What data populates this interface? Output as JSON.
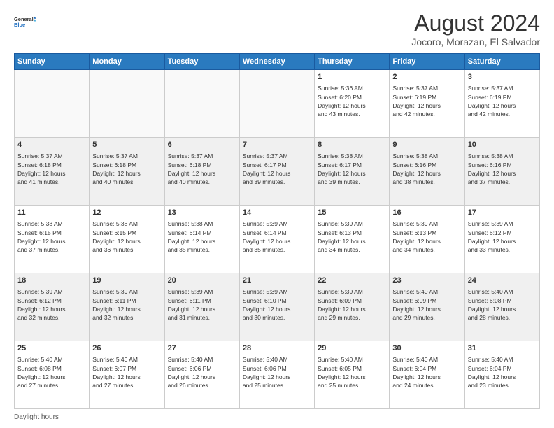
{
  "header": {
    "logo_line1": "General",
    "logo_line2": "Blue",
    "main_title": "August 2024",
    "subtitle": "Jocoro, Morazan, El Salvador"
  },
  "days_of_week": [
    "Sunday",
    "Monday",
    "Tuesday",
    "Wednesday",
    "Thursday",
    "Friday",
    "Saturday"
  ],
  "weeks": [
    [
      {
        "day": "",
        "info": "",
        "empty": true
      },
      {
        "day": "",
        "info": "",
        "empty": true
      },
      {
        "day": "",
        "info": "",
        "empty": true
      },
      {
        "day": "",
        "info": "",
        "empty": true
      },
      {
        "day": "1",
        "info": "Sunrise: 5:36 AM\nSunset: 6:20 PM\nDaylight: 12 hours\nand 43 minutes."
      },
      {
        "day": "2",
        "info": "Sunrise: 5:37 AM\nSunset: 6:19 PM\nDaylight: 12 hours\nand 42 minutes."
      },
      {
        "day": "3",
        "info": "Sunrise: 5:37 AM\nSunset: 6:19 PM\nDaylight: 12 hours\nand 42 minutes."
      }
    ],
    [
      {
        "day": "4",
        "info": "Sunrise: 5:37 AM\nSunset: 6:18 PM\nDaylight: 12 hours\nand 41 minutes."
      },
      {
        "day": "5",
        "info": "Sunrise: 5:37 AM\nSunset: 6:18 PM\nDaylight: 12 hours\nand 40 minutes."
      },
      {
        "day": "6",
        "info": "Sunrise: 5:37 AM\nSunset: 6:18 PM\nDaylight: 12 hours\nand 40 minutes."
      },
      {
        "day": "7",
        "info": "Sunrise: 5:37 AM\nSunset: 6:17 PM\nDaylight: 12 hours\nand 39 minutes."
      },
      {
        "day": "8",
        "info": "Sunrise: 5:38 AM\nSunset: 6:17 PM\nDaylight: 12 hours\nand 39 minutes."
      },
      {
        "day": "9",
        "info": "Sunrise: 5:38 AM\nSunset: 6:16 PM\nDaylight: 12 hours\nand 38 minutes."
      },
      {
        "day": "10",
        "info": "Sunrise: 5:38 AM\nSunset: 6:16 PM\nDaylight: 12 hours\nand 37 minutes."
      }
    ],
    [
      {
        "day": "11",
        "info": "Sunrise: 5:38 AM\nSunset: 6:15 PM\nDaylight: 12 hours\nand 37 minutes."
      },
      {
        "day": "12",
        "info": "Sunrise: 5:38 AM\nSunset: 6:15 PM\nDaylight: 12 hours\nand 36 minutes."
      },
      {
        "day": "13",
        "info": "Sunrise: 5:38 AM\nSunset: 6:14 PM\nDaylight: 12 hours\nand 35 minutes."
      },
      {
        "day": "14",
        "info": "Sunrise: 5:39 AM\nSunset: 6:14 PM\nDaylight: 12 hours\nand 35 minutes."
      },
      {
        "day": "15",
        "info": "Sunrise: 5:39 AM\nSunset: 6:13 PM\nDaylight: 12 hours\nand 34 minutes."
      },
      {
        "day": "16",
        "info": "Sunrise: 5:39 AM\nSunset: 6:13 PM\nDaylight: 12 hours\nand 34 minutes."
      },
      {
        "day": "17",
        "info": "Sunrise: 5:39 AM\nSunset: 6:12 PM\nDaylight: 12 hours\nand 33 minutes."
      }
    ],
    [
      {
        "day": "18",
        "info": "Sunrise: 5:39 AM\nSunset: 6:12 PM\nDaylight: 12 hours\nand 32 minutes."
      },
      {
        "day": "19",
        "info": "Sunrise: 5:39 AM\nSunset: 6:11 PM\nDaylight: 12 hours\nand 32 minutes."
      },
      {
        "day": "20",
        "info": "Sunrise: 5:39 AM\nSunset: 6:11 PM\nDaylight: 12 hours\nand 31 minutes."
      },
      {
        "day": "21",
        "info": "Sunrise: 5:39 AM\nSunset: 6:10 PM\nDaylight: 12 hours\nand 30 minutes."
      },
      {
        "day": "22",
        "info": "Sunrise: 5:39 AM\nSunset: 6:09 PM\nDaylight: 12 hours\nand 29 minutes."
      },
      {
        "day": "23",
        "info": "Sunrise: 5:40 AM\nSunset: 6:09 PM\nDaylight: 12 hours\nand 29 minutes."
      },
      {
        "day": "24",
        "info": "Sunrise: 5:40 AM\nSunset: 6:08 PM\nDaylight: 12 hours\nand 28 minutes."
      }
    ],
    [
      {
        "day": "25",
        "info": "Sunrise: 5:40 AM\nSunset: 6:08 PM\nDaylight: 12 hours\nand 27 minutes."
      },
      {
        "day": "26",
        "info": "Sunrise: 5:40 AM\nSunset: 6:07 PM\nDaylight: 12 hours\nand 27 minutes."
      },
      {
        "day": "27",
        "info": "Sunrise: 5:40 AM\nSunset: 6:06 PM\nDaylight: 12 hours\nand 26 minutes."
      },
      {
        "day": "28",
        "info": "Sunrise: 5:40 AM\nSunset: 6:06 PM\nDaylight: 12 hours\nand 25 minutes."
      },
      {
        "day": "29",
        "info": "Sunrise: 5:40 AM\nSunset: 6:05 PM\nDaylight: 12 hours\nand 25 minutes."
      },
      {
        "day": "30",
        "info": "Sunrise: 5:40 AM\nSunset: 6:04 PM\nDaylight: 12 hours\nand 24 minutes."
      },
      {
        "day": "31",
        "info": "Sunrise: 5:40 AM\nSunset: 6:04 PM\nDaylight: 12 hours\nand 23 minutes."
      }
    ]
  ],
  "footer": {
    "label": "Daylight hours"
  }
}
